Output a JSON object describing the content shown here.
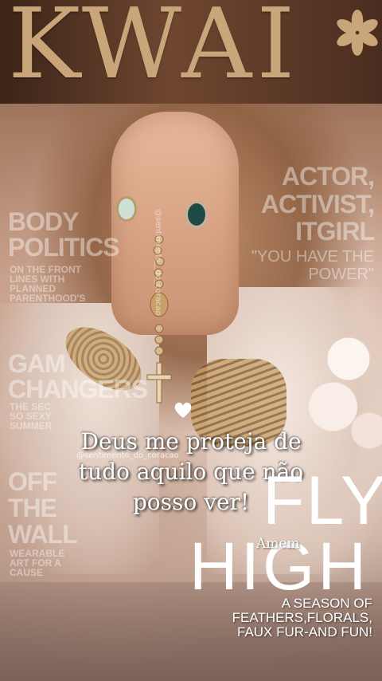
{
  "header": {
    "logo_text": "KWAI",
    "logo_icon": "flower-asterisk-icon",
    "logo_color": "#c9a67a"
  },
  "magazine_left": {
    "body_politics": "BODY POLITICS",
    "front_lines": "ON THE FRONT LINES WITH PLANNED PARENTHOOD'S",
    "game_changers_1": "GAM",
    "game_changers_2": "CHANGERS",
    "season_sexy": "THE SEC SO SEXY SUMMER",
    "off_the_wall_1": "OFF",
    "off_the_wall_2": "THE",
    "off_the_wall_3": "WALL",
    "wearable_art": "WEARABLE ART FOR A CAUSE"
  },
  "magazine_right": {
    "actor": "ACTOR,",
    "activist": "ACTIVIST,",
    "itgirl": "ITGIRL",
    "you_have": "\"YOU HAVE THE",
    "power": "POWER\""
  },
  "watermark": {
    "handle": "@sentimento_do_coracao",
    "handle_vertical": "@sentimento__do_coracao"
  },
  "quote": {
    "line1": "Deus me proteja de",
    "line2": "tudo aquilo que não",
    "line3": "posso ver!",
    "icon": "heart-icon"
  },
  "cover": {
    "fly": "FLY",
    "high": "HIGH",
    "amem": "Amem",
    "season_line1": "A SEASON OF",
    "season_line2": "FEATHERS,FLORALS,",
    "season_line3": "FAUX FUR-AND FUN!"
  }
}
